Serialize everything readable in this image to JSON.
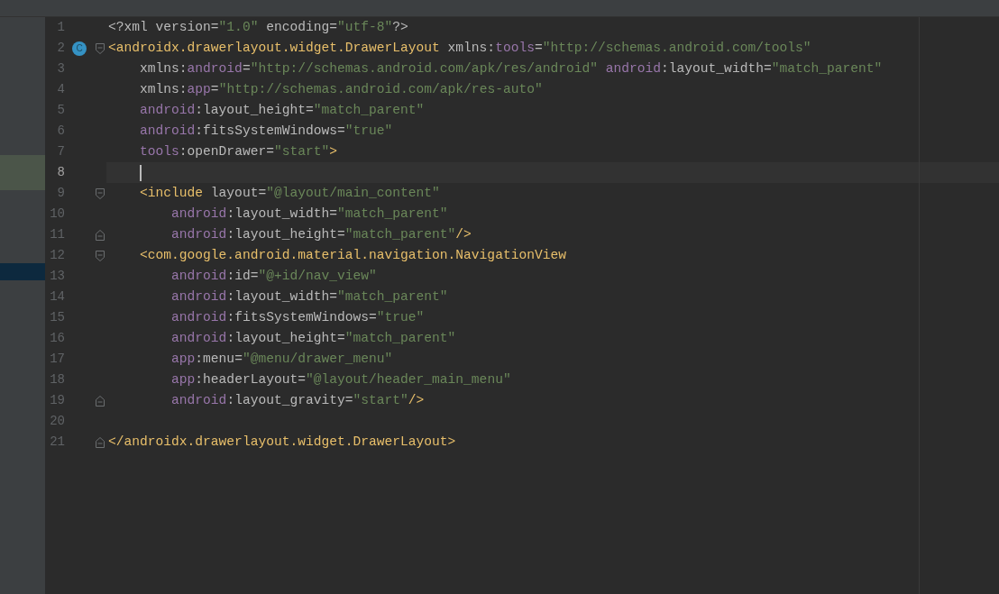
{
  "editor": {
    "lines": [
      {
        "number": "1",
        "current": false,
        "fold_start": false,
        "fold_end": false,
        "tokens": [
          {
            "kind": "text",
            "text": "<?xml version="
          },
          {
            "kind": "string",
            "text": "\"1.0\""
          },
          {
            "kind": "text",
            "text": " encoding="
          },
          {
            "kind": "string",
            "text": "\"utf-8\""
          },
          {
            "kind": "text",
            "text": "?>"
          }
        ]
      },
      {
        "number": "2",
        "current": false,
        "badge": "C",
        "fold_start": true,
        "fold_end": false,
        "tokens": [
          {
            "kind": "tag",
            "text": "<androidx.drawerlayout.widget.DrawerLayout"
          },
          {
            "kind": "text",
            "text": " xmlns:"
          },
          {
            "kind": "ns",
            "text": "tools"
          },
          {
            "kind": "text",
            "text": "="
          },
          {
            "kind": "string",
            "text": "\"http://schemas.android.com/tools\""
          }
        ]
      },
      {
        "number": "3",
        "current": false,
        "fold_start": false,
        "fold_end": false,
        "tokens": [
          {
            "kind": "text",
            "text": "    xmlns:"
          },
          {
            "kind": "ns",
            "text": "android"
          },
          {
            "kind": "text",
            "text": "="
          },
          {
            "kind": "string",
            "text": "\"http://schemas.android.com/apk/res/android\""
          },
          {
            "kind": "ns",
            "text": " android"
          },
          {
            "kind": "text",
            "text": ":layout_width="
          },
          {
            "kind": "string",
            "text": "\"match_parent\""
          }
        ]
      },
      {
        "number": "4",
        "current": false,
        "fold_start": false,
        "fold_end": false,
        "tokens": [
          {
            "kind": "text",
            "text": "    xmlns:"
          },
          {
            "kind": "ns",
            "text": "app"
          },
          {
            "kind": "text",
            "text": "="
          },
          {
            "kind": "string",
            "text": "\"http://schemas.android.com/apk/res-auto\""
          }
        ]
      },
      {
        "number": "5",
        "current": false,
        "fold_start": false,
        "fold_end": false,
        "tokens": [
          {
            "kind": "ns",
            "text": "    android"
          },
          {
            "kind": "text",
            "text": ":layout_height="
          },
          {
            "kind": "string",
            "text": "\"match_parent\""
          }
        ]
      },
      {
        "number": "6",
        "current": false,
        "fold_start": false,
        "fold_end": false,
        "tokens": [
          {
            "kind": "ns",
            "text": "    android"
          },
          {
            "kind": "text",
            "text": ":fitsSystemWindows="
          },
          {
            "kind": "string",
            "text": "\"true\""
          }
        ]
      },
      {
        "number": "7",
        "current": false,
        "fold_start": false,
        "fold_end": false,
        "tokens": [
          {
            "kind": "ns",
            "text": "    tools"
          },
          {
            "kind": "text",
            "text": ":openDrawer="
          },
          {
            "kind": "string",
            "text": "\"start\""
          },
          {
            "kind": "tag",
            "text": ">"
          }
        ]
      },
      {
        "number": "8",
        "current": true,
        "fold_start": false,
        "fold_end": false
      },
      {
        "number": "9",
        "current": false,
        "fold_start": true,
        "fold_end": false,
        "tokens": [
          {
            "kind": "tag",
            "text": "    <include"
          },
          {
            "kind": "text",
            "text": " layout="
          },
          {
            "kind": "string",
            "text": "\"@layout/main_content\""
          }
        ]
      },
      {
        "number": "10",
        "current": false,
        "fold_start": false,
        "fold_end": false,
        "tokens": [
          {
            "kind": "ns",
            "text": "        android"
          },
          {
            "kind": "text",
            "text": ":layout_width="
          },
          {
            "kind": "string",
            "text": "\"match_parent\""
          }
        ]
      },
      {
        "number": "11",
        "current": false,
        "fold_start": false,
        "fold_end": true,
        "tokens": [
          {
            "kind": "ns",
            "text": "        android"
          },
          {
            "kind": "text",
            "text": ":layout_height="
          },
          {
            "kind": "string",
            "text": "\"match_parent\""
          },
          {
            "kind": "tag",
            "text": "/>"
          }
        ]
      },
      {
        "number": "12",
        "current": false,
        "fold_start": true,
        "fold_end": false,
        "tokens": [
          {
            "kind": "tag",
            "text": "    <com.google.android.material.navigation.NavigationView"
          }
        ]
      },
      {
        "number": "13",
        "current": false,
        "fold_start": false,
        "fold_end": false,
        "tokens": [
          {
            "kind": "ns",
            "text": "        android"
          },
          {
            "kind": "text",
            "text": ":id="
          },
          {
            "kind": "string",
            "text": "\"@+id/nav_view\""
          }
        ]
      },
      {
        "number": "14",
        "current": false,
        "fold_start": false,
        "fold_end": false,
        "tokens": [
          {
            "kind": "ns",
            "text": "        android"
          },
          {
            "kind": "text",
            "text": ":layout_width="
          },
          {
            "kind": "string",
            "text": "\"match_parent\""
          }
        ]
      },
      {
        "number": "15",
        "current": false,
        "fold_start": false,
        "fold_end": false,
        "tokens": [
          {
            "kind": "ns",
            "text": "        android"
          },
          {
            "kind": "text",
            "text": ":fitsSystemWindows="
          },
          {
            "kind": "string",
            "text": "\"true\""
          }
        ]
      },
      {
        "number": "16",
        "current": false,
        "fold_start": false,
        "fold_end": false,
        "tokens": [
          {
            "kind": "ns",
            "text": "        android"
          },
          {
            "kind": "text",
            "text": ":layout_height="
          },
          {
            "kind": "string",
            "text": "\"match_parent\""
          }
        ]
      },
      {
        "number": "17",
        "current": false,
        "fold_start": false,
        "fold_end": false,
        "tokens": [
          {
            "kind": "ns",
            "text": "        app"
          },
          {
            "kind": "text",
            "text": ":menu="
          },
          {
            "kind": "string",
            "text": "\"@menu/drawer_menu\""
          }
        ]
      },
      {
        "number": "18",
        "current": false,
        "fold_start": false,
        "fold_end": false,
        "tokens": [
          {
            "kind": "ns",
            "text": "        app"
          },
          {
            "kind": "text",
            "text": ":headerLayout="
          },
          {
            "kind": "string",
            "text": "\"@layout/header_main_menu\""
          }
        ]
      },
      {
        "number": "19",
        "current": false,
        "fold_start": false,
        "fold_end": true,
        "tokens": [
          {
            "kind": "ns",
            "text": "        android"
          },
          {
            "kind": "text",
            "text": ":layout_gravity="
          },
          {
            "kind": "string",
            "text": "\"start\""
          },
          {
            "kind": "tag",
            "text": "/>"
          }
        ]
      },
      {
        "number": "20",
        "current": false,
        "fold_start": false,
        "fold_end": false
      },
      {
        "number": "21",
        "current": false,
        "fold_start": false,
        "fold_end": true,
        "tokens": [
          {
            "kind": "tag",
            "text": "</androidx.drawerlayout.widget.DrawerLayout>"
          }
        ]
      }
    ]
  }
}
